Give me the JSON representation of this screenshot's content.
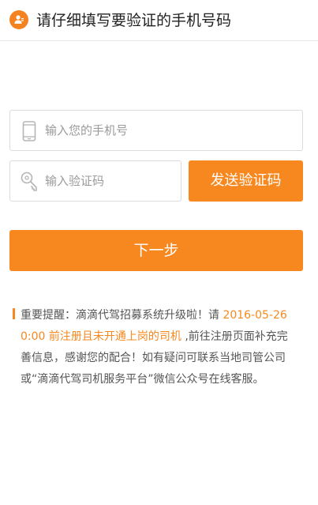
{
  "header": {
    "title": "请仔细填写要验证的手机号码",
    "icon": "user-badge-icon",
    "accent": "#f58220"
  },
  "form": {
    "phone_placeholder": "输入您的手机号",
    "code_placeholder": "输入验证码",
    "send_code_label": "发送验证码",
    "next_label": "下一步",
    "button_color": "#f7881f"
  },
  "notice": {
    "part1": "重要提醒：滴滴代驾招募系统升级啦！请 ",
    "highlight": "2016-05-26 0:00 前注册且未开通上岗的司机",
    "part2": " ,前往注册页面补充完善信息，感谢您的配合！如有疑问可联系当地司管公司或“滴滴代驾司机服务平台”微信公众号在线客服。"
  }
}
